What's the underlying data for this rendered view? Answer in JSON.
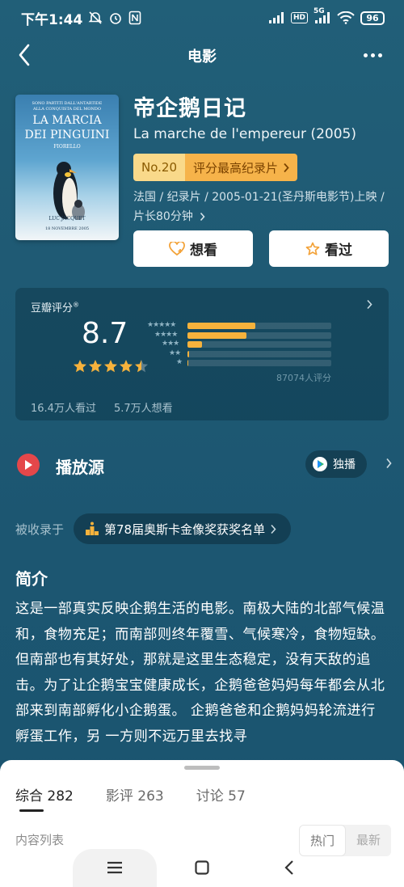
{
  "status_bar": {
    "time": "下午1:44",
    "hd": "HD",
    "network": "5G",
    "battery": "96"
  },
  "header": {
    "title": "电影"
  },
  "poster": {
    "line1": "SONO PARTITI DALL'ANTARTIDE",
    "line2": "ALLA CONQUISTA DEL MONDO",
    "title_a": "LA MARCIA",
    "title_b": "DEI PINGUINI",
    "credit": "FIORELLO",
    "director": "LUC JACQUET",
    "date": "18 NOVEMBRE 2005"
  },
  "movie": {
    "title_cn": "帝企鹅日记",
    "title_orig": "La marche de l'empereur (2005)",
    "rank_no": "No.20",
    "rank_label": "评分最高纪录片",
    "meta_line1": "法国 / 纪录片 / 2005-01-21(圣丹斯电影节)上映 /",
    "meta_line2": "片长80分钟"
  },
  "actions": {
    "want": "想看",
    "watched": "看过"
  },
  "rating": {
    "title": "豆瓣评分",
    "score": "8.7",
    "stars_filled": 4.5,
    "distribution": [
      {
        "stars": "★★★★★",
        "pct": 47
      },
      {
        "stars": "★★★★",
        "pct": 41
      },
      {
        "stars": "★★★",
        "pct": 10
      },
      {
        "stars": "★★",
        "pct": 1
      },
      {
        "stars": "★",
        "pct": 0.3
      }
    ],
    "count": "87074人评分",
    "watched_count": "16.4万人看过",
    "want_count": "5.7万人想看"
  },
  "play": {
    "label": "播放源",
    "exclusive": "独播"
  },
  "collected": {
    "label": "被收录于",
    "chip": "第78届奥斯卡金像奖获奖名单"
  },
  "synopsis": {
    "title": "简介",
    "text": "这是一部真实反映企鹅生活的电影。南极大陆的北部气候温和，食物充足；而南部则终年覆雪、气候寒冷，食物短缺。但南部也有其好处，那就是这里生态稳定，没有天敌的追击。为了让企鹅宝宝健康成长，企鹅爸爸妈妈每年都会从北部来到南部孵化小企鹅蛋。 企鹅爸爸和企鹅妈妈轮流进行孵蛋工作，另 一方则不远万里去找寻"
  },
  "sheet": {
    "tabs": [
      {
        "label": "综合",
        "count": "282"
      },
      {
        "label": "影评",
        "count": "263"
      },
      {
        "label": "讨论",
        "count": "57"
      }
    ],
    "list_label": "内容列表",
    "sort_hot": "热门",
    "sort_new": "最新"
  },
  "colors": {
    "background": "#1f5a74",
    "accent": "#f6b23c",
    "play": "#e4474a"
  }
}
